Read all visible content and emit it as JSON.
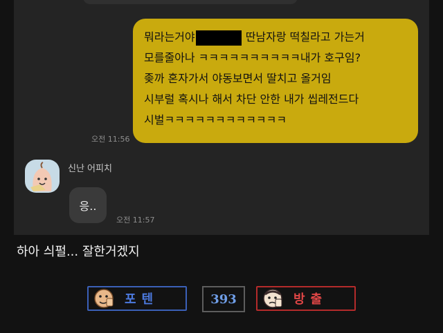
{
  "chat": {
    "outgoing": {
      "lines": [
        {
          "before": "뭐라는거야",
          "after": " 딴남자랑 떡칠라고 가는거"
        },
        {
          "text": "모를줄아나 ㅋㅋㅋㅋㅋㅋㅋㅋㅋㅋ내가 호구임?"
        },
        {
          "text": "좆까 혼자가서 야동보면서 딸치고 올거임"
        },
        {
          "text": "시부럴 혹시나 해서 차단 안한 내가 씹레전드다"
        },
        {
          "text": "시벌ㅋㅋㅋㅋㅋㅋㅋㅋㅋㅋㅋㅋ"
        }
      ],
      "time": "오전 11:56"
    },
    "incoming": {
      "sender": "신난 어피치",
      "message": "응..",
      "time": "오전 11:57",
      "avatar_icon": "apeach-avatar-icon"
    }
  },
  "post": {
    "caption": "하아 싀펄... 잘한거겠지"
  },
  "votes": {
    "up_label": "포텐",
    "count": "393",
    "down_label": "방출",
    "up_color": "#3b60b8",
    "down_color": "#b52b2b"
  }
}
